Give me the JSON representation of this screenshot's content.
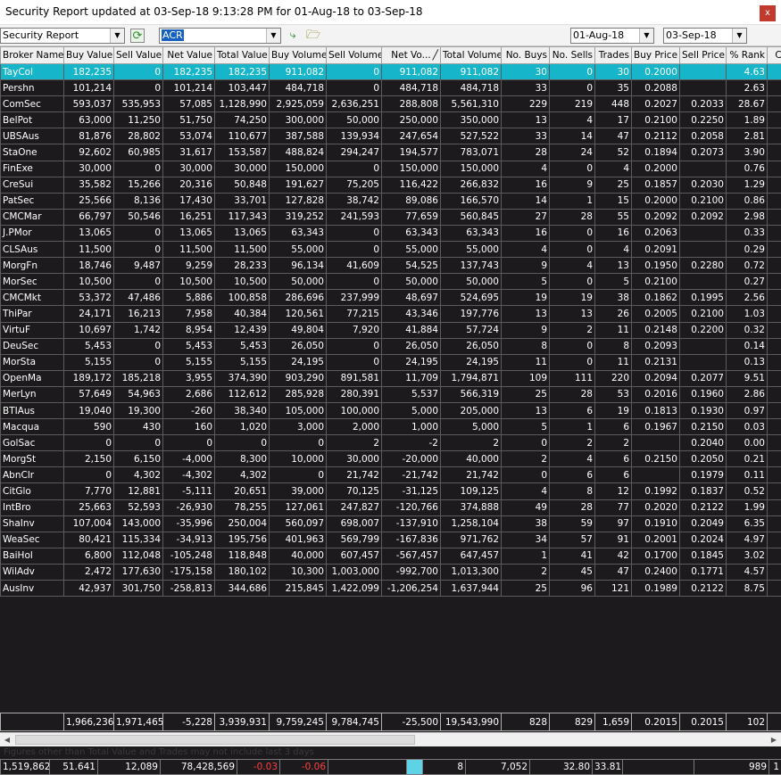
{
  "window": {
    "title": "Security Report updated at 03-Sep-18 9:13:28 PM for 01-Aug-18 to 03-Sep-18",
    "close_label": "x"
  },
  "toolbar": {
    "report_type": "Security Report",
    "security_code": "ACR",
    "date_from": "01-Aug-18",
    "date_to": "03-Sep-18"
  },
  "columns": [
    "Broker Name",
    "Buy Value",
    "Sell Value",
    "Net Value",
    "Total Value",
    "Buy Volume",
    "Sell Volume",
    "Net Vo...",
    "Total Volume",
    "No. Buys",
    "No. Sells",
    "Trades",
    "Buy Price",
    "Sell Price",
    "% Rank",
    "Call"
  ],
  "sort_indicator": "╱",
  "rows": [
    [
      "TayCol",
      "182,235",
      "0",
      "182,235",
      "182,235",
      "911,082",
      "0",
      "911,082",
      "911,082",
      "30",
      "0",
      "30",
      "0.2000",
      "",
      "4.63",
      ""
    ],
    [
      "Pershn",
      "101,214",
      "0",
      "101,214",
      "103,447",
      "484,718",
      "0",
      "484,718",
      "484,718",
      "33",
      "0",
      "35",
      "0.2088",
      "",
      "2.63",
      ""
    ],
    [
      "ComSec",
      "593,037",
      "535,953",
      "57,085",
      "1,128,990",
      "2,925,059",
      "2,636,251",
      "288,808",
      "5,561,310",
      "229",
      "219",
      "448",
      "0.2027",
      "0.2033",
      "28.67",
      ""
    ],
    [
      "BelPot",
      "63,000",
      "11,250",
      "51,750",
      "74,250",
      "300,000",
      "50,000",
      "250,000",
      "350,000",
      "13",
      "4",
      "17",
      "0.2100",
      "0.2250",
      "1.89",
      ""
    ],
    [
      "UBSAus",
      "81,876",
      "28,802",
      "53,074",
      "110,677",
      "387,588",
      "139,934",
      "247,654",
      "527,522",
      "33",
      "14",
      "47",
      "0.2112",
      "0.2058",
      "2.81",
      ""
    ],
    [
      "StaOne",
      "92,602",
      "60,985",
      "31,617",
      "153,587",
      "488,824",
      "294,247",
      "194,577",
      "783,071",
      "28",
      "24",
      "52",
      "0.1894",
      "0.2073",
      "3.90",
      ""
    ],
    [
      "FinExe",
      "30,000",
      "0",
      "30,000",
      "30,000",
      "150,000",
      "0",
      "150,000",
      "150,000",
      "4",
      "0",
      "4",
      "0.2000",
      "",
      "0.76",
      ""
    ],
    [
      "CreSui",
      "35,582",
      "15,266",
      "20,316",
      "50,848",
      "191,627",
      "75,205",
      "116,422",
      "266,832",
      "16",
      "9",
      "25",
      "0.1857",
      "0.2030",
      "1.29",
      ""
    ],
    [
      "PatSec",
      "25,566",
      "8,136",
      "17,430",
      "33,701",
      "127,828",
      "38,742",
      "89,086",
      "166,570",
      "14",
      "1",
      "15",
      "0.2000",
      "0.2100",
      "0.86",
      ""
    ],
    [
      "CMCMar",
      "66,797",
      "50,546",
      "16,251",
      "117,343",
      "319,252",
      "241,593",
      "77,659",
      "560,845",
      "27",
      "28",
      "55",
      "0.2092",
      "0.2092",
      "2.98",
      ""
    ],
    [
      "J.PMor",
      "13,065",
      "0",
      "13,065",
      "13,065",
      "63,343",
      "0",
      "63,343",
      "63,343",
      "16",
      "0",
      "16",
      "0.2063",
      "",
      "0.33",
      ""
    ],
    [
      "CLSAus",
      "11,500",
      "0",
      "11,500",
      "11,500",
      "55,000",
      "0",
      "55,000",
      "55,000",
      "4",
      "0",
      "4",
      "0.2091",
      "",
      "0.29",
      ""
    ],
    [
      "MorgFn",
      "18,746",
      "9,487",
      "9,259",
      "28,233",
      "96,134",
      "41,609",
      "54,525",
      "137,743",
      "9",
      "4",
      "13",
      "0.1950",
      "0.2280",
      "0.72",
      ""
    ],
    [
      "MorSec",
      "10,500",
      "0",
      "10,500",
      "10,500",
      "50,000",
      "0",
      "50,000",
      "50,000",
      "5",
      "0",
      "5",
      "0.2100",
      "",
      "0.27",
      ""
    ],
    [
      "CMCMkt",
      "53,372",
      "47,486",
      "5,886",
      "100,858",
      "286,696",
      "237,999",
      "48,697",
      "524,695",
      "19",
      "19",
      "38",
      "0.1862",
      "0.1995",
      "2.56",
      ""
    ],
    [
      "ThiPar",
      "24,171",
      "16,213",
      "7,958",
      "40,384",
      "120,561",
      "77,215",
      "43,346",
      "197,776",
      "13",
      "13",
      "26",
      "0.2005",
      "0.2100",
      "1.03",
      ""
    ],
    [
      "VirtuF",
      "10,697",
      "1,742",
      "8,954",
      "12,439",
      "49,804",
      "7,920",
      "41,884",
      "57,724",
      "9",
      "2",
      "11",
      "0.2148",
      "0.2200",
      "0.32",
      ""
    ],
    [
      "DeuSec",
      "5,453",
      "0",
      "5,453",
      "5,453",
      "26,050",
      "0",
      "26,050",
      "26,050",
      "8",
      "0",
      "8",
      "0.2093",
      "",
      "0.14",
      ""
    ],
    [
      "MorSta",
      "5,155",
      "0",
      "5,155",
      "5,155",
      "24,195",
      "0",
      "24,195",
      "24,195",
      "11",
      "0",
      "11",
      "0.2131",
      "",
      "0.13",
      ""
    ],
    [
      "OpenMa",
      "189,172",
      "185,218",
      "3,955",
      "374,390",
      "903,290",
      "891,581",
      "11,709",
      "1,794,871",
      "109",
      "111",
      "220",
      "0.2094",
      "0.2077",
      "9.51",
      ""
    ],
    [
      "MerLyn",
      "57,649",
      "54,963",
      "2,686",
      "112,612",
      "285,928",
      "280,391",
      "5,537",
      "566,319",
      "25",
      "28",
      "53",
      "0.2016",
      "0.1960",
      "2.86",
      ""
    ],
    [
      "BTIAus",
      "19,040",
      "19,300",
      "-260",
      "38,340",
      "105,000",
      "100,000",
      "5,000",
      "205,000",
      "13",
      "6",
      "19",
      "0.1813",
      "0.1930",
      "0.97",
      ""
    ],
    [
      "Macqua",
      "590",
      "430",
      "160",
      "1,020",
      "3,000",
      "2,000",
      "1,000",
      "5,000",
      "5",
      "1",
      "6",
      "0.1967",
      "0.2150",
      "0.03",
      ""
    ],
    [
      "GolSac",
      "0",
      "0",
      "0",
      "0",
      "0",
      "2",
      "-2",
      "2",
      "0",
      "2",
      "2",
      "",
      "0.2040",
      "0.00",
      ""
    ],
    [
      "MorgSt",
      "2,150",
      "6,150",
      "-4,000",
      "8,300",
      "10,000",
      "30,000",
      "-20,000",
      "40,000",
      "2",
      "4",
      "6",
      "0.2150",
      "0.2050",
      "0.21",
      ""
    ],
    [
      "AbnClr",
      "0",
      "4,302",
      "-4,302",
      "4,302",
      "0",
      "21,742",
      "-21,742",
      "21,742",
      "0",
      "6",
      "6",
      "",
      "0.1979",
      "0.11",
      ""
    ],
    [
      "CitGlo",
      "7,770",
      "12,881",
      "-5,111",
      "20,651",
      "39,000",
      "70,125",
      "-31,125",
      "109,125",
      "4",
      "8",
      "12",
      "0.1992",
      "0.1837",
      "0.52",
      ""
    ],
    [
      "IntBro",
      "25,663",
      "52,593",
      "-26,930",
      "78,255",
      "127,061",
      "247,827",
      "-120,766",
      "374,888",
      "49",
      "28",
      "77",
      "0.2020",
      "0.2122",
      "1.99",
      ""
    ],
    [
      "ShaInv",
      "107,004",
      "143,000",
      "-35,996",
      "250,004",
      "560,097",
      "698,007",
      "-137,910",
      "1,258,104",
      "38",
      "59",
      "97",
      "0.1910",
      "0.2049",
      "6.35",
      ""
    ],
    [
      "WeaSec",
      "80,421",
      "115,334",
      "-34,913",
      "195,756",
      "401,963",
      "569,799",
      "-167,836",
      "971,762",
      "34",
      "57",
      "91",
      "0.2001",
      "0.2024",
      "4.97",
      ""
    ],
    [
      "BaiHol",
      "6,800",
      "112,048",
      "-105,248",
      "118,848",
      "40,000",
      "607,457",
      "-567,457",
      "647,457",
      "1",
      "41",
      "42",
      "0.1700",
      "0.1845",
      "3.02",
      ""
    ],
    [
      "WilAdv",
      "2,472",
      "177,630",
      "-175,158",
      "180,102",
      "10,300",
      "1,003,000",
      "-992,700",
      "1,013,300",
      "2",
      "45",
      "47",
      "0.2400",
      "0.1771",
      "4.57",
      ""
    ],
    [
      "AusInv",
      "42,937",
      "301,750",
      "-258,813",
      "344,686",
      "215,845",
      "1,422,099",
      "-1,206,254",
      "1,637,944",
      "25",
      "96",
      "121",
      "0.1989",
      "0.2122",
      "8.75",
      ""
    ]
  ],
  "totals": [
    "",
    "1,966,236",
    "1,971,465",
    "-5,228",
    "3,939,931",
    "9,759,245",
    "9,784,745",
    "-25,500",
    "19,543,990",
    "828",
    "829",
    "1,659",
    "0.2015",
    "0.2015",
    "102",
    ""
  ],
  "footnote": "Figures other than Total Value and Trades may not include last 3 days",
  "statusbar": [
    {
      "text": "1,519,862",
      "cls": ""
    },
    {
      "text": "51.641",
      "cls": ""
    },
    {
      "text": "12,089",
      "cls": ""
    },
    {
      "text": "78,428,569",
      "cls": ""
    },
    {
      "text": "-0.03",
      "cls": "neg"
    },
    {
      "text": "-0.06",
      "cls": "neg"
    },
    {
      "text": "",
      "cls": ""
    },
    {
      "text": "",
      "cls": "cyan"
    },
    {
      "text": "8",
      "cls": ""
    },
    {
      "text": "7,052",
      "cls": ""
    },
    {
      "text": "32.80",
      "cls": ""
    },
    {
      "text": "33.81",
      "cls": ""
    },
    {
      "text": "",
      "cls": ""
    },
    {
      "text": "989",
      "cls": ""
    },
    {
      "text": "1",
      "cls": ""
    }
  ]
}
